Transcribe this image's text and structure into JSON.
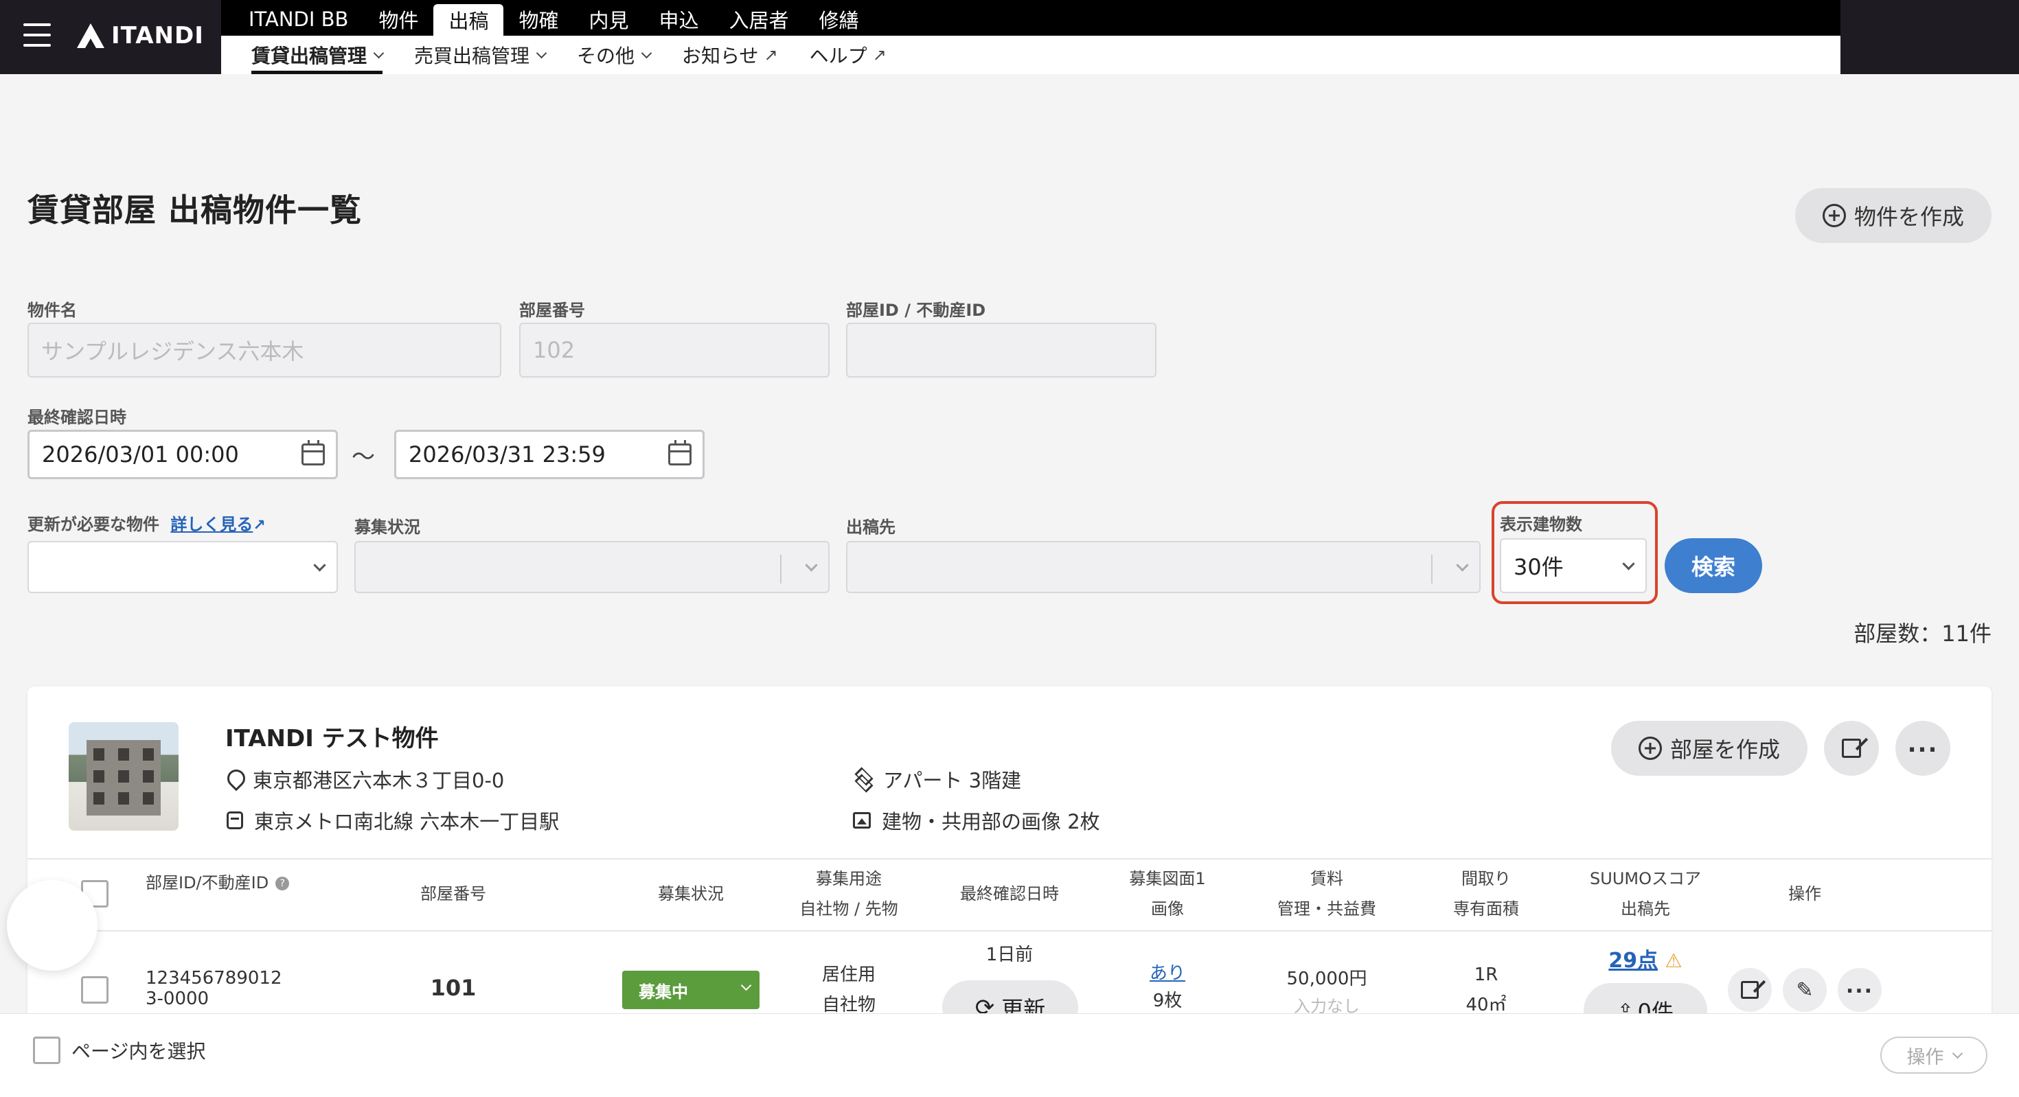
{
  "header": {
    "logo": "ITANDI",
    "tabs": [
      "ITANDI BB",
      "物件",
      "出稿",
      "物確",
      "内見",
      "申込",
      "入居者",
      "修繕"
    ],
    "active_tab": "出稿",
    "subnav": [
      {
        "label": "賃貸出稿管理",
        "kind": "dropdown"
      },
      {
        "label": "売買出稿管理",
        "kind": "dropdown"
      },
      {
        "label": "その他",
        "kind": "dropdown"
      },
      {
        "label": "お知らせ",
        "kind": "external"
      },
      {
        "label": "ヘルプ",
        "kind": "external"
      }
    ]
  },
  "page": {
    "title": "賃貸部屋 出稿物件一覧",
    "create_button": "物件を作成"
  },
  "filters": {
    "building_name": {
      "label": "物件名",
      "placeholder": "サンプルレジデンス六本木"
    },
    "room_number": {
      "label": "部屋番号",
      "placeholder": "102"
    },
    "room_id": {
      "label": "部屋ID / 不動産ID",
      "placeholder": ""
    },
    "last_confirmed": {
      "label": "最終確認日時",
      "from": "2026/03/01 00:00",
      "separator": "〜",
      "to": "2026/03/31 23:59"
    },
    "needs_update": {
      "label": "更新が必要な物件",
      "link": "詳しく見る",
      "value": ""
    },
    "recruit_status": {
      "label": "募集状況",
      "value": ""
    },
    "destination": {
      "label": "出稿先",
      "value": ""
    },
    "display_count": {
      "label": "表示建物数",
      "value": "30件"
    },
    "search_button": "検索"
  },
  "result_count": "部屋数：11件",
  "building": {
    "name": "ITANDI テスト物件",
    "address": "東京都港区六本木３丁目0-0",
    "station": "東京メトロ南北線 六本木一丁目駅",
    "type": "アパート 3階建",
    "images": "建物・共用部の画像 2枚",
    "create_room_button": "部屋を作成"
  },
  "table": {
    "headers": {
      "room_id": "部屋ID/不動産ID",
      "room_number": "部屋番号",
      "status": "募集状況",
      "usage_1": "募集用途",
      "usage_2": "自社物 / 先物",
      "last_confirmed": "最終確認日時",
      "plan_1": "募集図面1",
      "plan_2": "画像",
      "rent_1": "賃料",
      "rent_2": "管理・共益費",
      "layout_1": "間取り",
      "layout_2": "専有面積",
      "suumo_1": "SUUMOスコア",
      "suumo_2": "出稿先",
      "ops": "操作"
    },
    "rows": [
      {
        "room_id": "1234567890123-0000",
        "room_number": "101",
        "status": "募集中",
        "usage": "居住用",
        "ownership": "自社物",
        "last_confirmed": "1日前",
        "update_button": "更新",
        "plan_link": "あり",
        "image_count": "9枚",
        "rent": "50,000円",
        "fee": "入力なし",
        "layout": "1R",
        "area": "40㎡",
        "suumo_score": "29点",
        "destinations": "0件"
      }
    ]
  },
  "bottom": {
    "select_page": "ページ内を選択",
    "ops_button": "操作"
  },
  "colors": {
    "header_bg": "#1e1b22",
    "primary": "#3e7fd0",
    "status_green": "#5b9c3d",
    "highlight_red": "#d9442c",
    "warning": "#e8a33a",
    "link": "#2563b8"
  }
}
